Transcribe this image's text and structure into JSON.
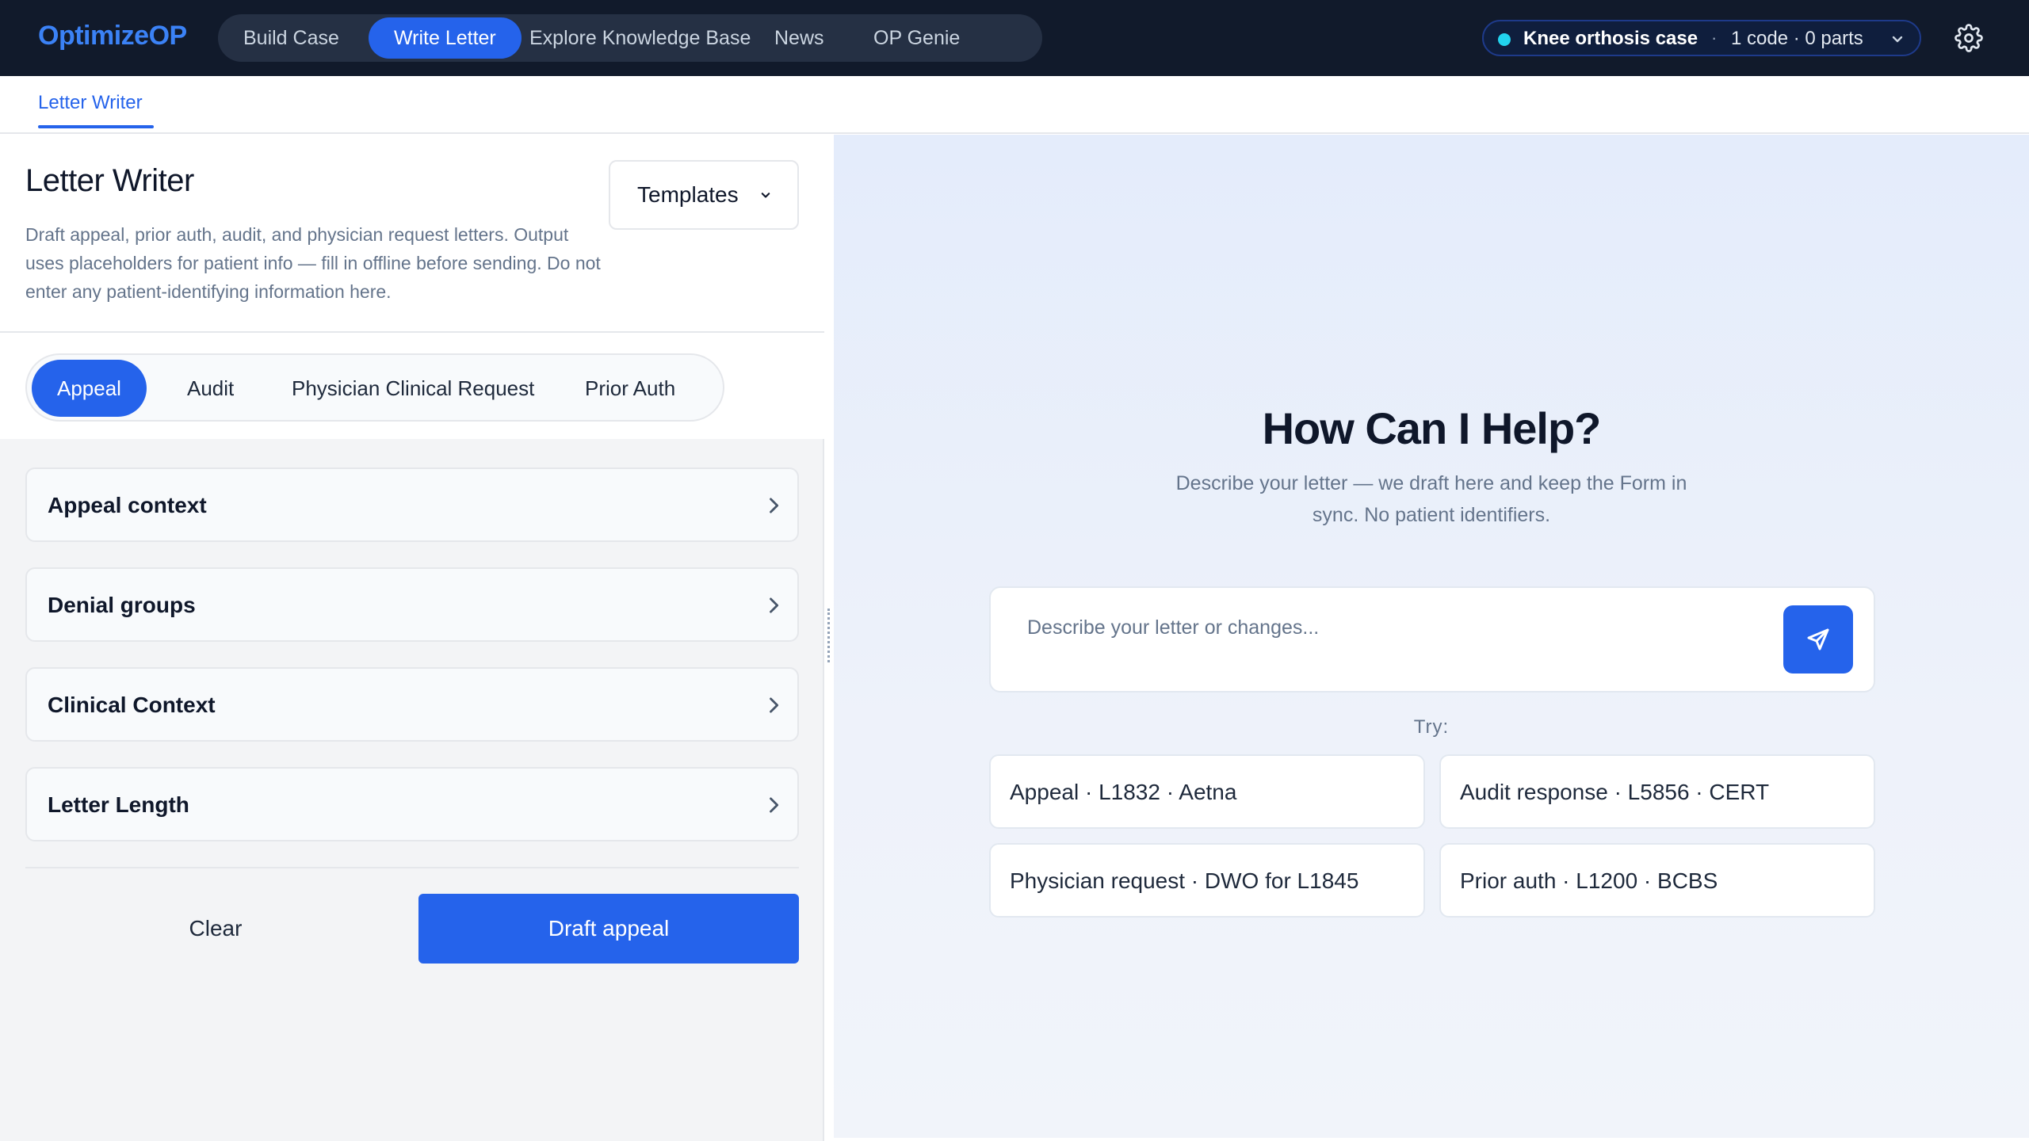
{
  "app": {
    "logo": "OptimizeOP",
    "nav": [
      {
        "label": "Build Case",
        "active": false
      },
      {
        "label": "Write Letter",
        "active": true
      },
      {
        "label": "Explore Knowledge Base",
        "active": false
      },
      {
        "label": "News",
        "active": false
      },
      {
        "label": "OP Genie",
        "active": false
      }
    ],
    "case_selector": {
      "name": "Knee orthosis case",
      "separator": "·",
      "meta": "1 code · 0 parts",
      "status_color": "#22d3ee"
    },
    "settings_icon": "gear-icon"
  },
  "subnav": {
    "tab": "Letter Writer"
  },
  "left_panel": {
    "title": "Letter Writer",
    "description": "Draft appeal, prior auth, audit, and physician request letters. Output uses placeholders for patient info — fill in offline before sending. Do not enter any patient-identifying information here.",
    "templates_button": "Templates",
    "letter_types": [
      {
        "label": "Appeal",
        "active": true
      },
      {
        "label": "Audit",
        "active": false
      },
      {
        "label": "Physician Clinical Request",
        "active": false
      },
      {
        "label": "Prior Auth",
        "active": false
      }
    ],
    "sections": [
      {
        "label": "Appeal context"
      },
      {
        "label": "Denial groups"
      },
      {
        "label": "Clinical Context"
      },
      {
        "label": "Letter Length"
      }
    ],
    "clear_button": "Clear",
    "draft_button": "Draft appeal"
  },
  "right_panel": {
    "title": "How Can I Help?",
    "subtitle": "Describe your letter — we draft here and keep the Form in sync. No patient identifiers.",
    "composer": {
      "placeholder": "Describe your letter or changes...",
      "value": ""
    },
    "try_label": "Try:",
    "suggestions": [
      {
        "label": "Appeal · L1832 · Aetna"
      },
      {
        "label": "Audit response · L5856 · CERT"
      },
      {
        "label": "Physician request · DWO for L1845"
      },
      {
        "label": "Prior auth · L1200 · BCBS"
      }
    ]
  },
  "colors": {
    "accent": "#2563eb",
    "topbar": "#111a2b"
  }
}
